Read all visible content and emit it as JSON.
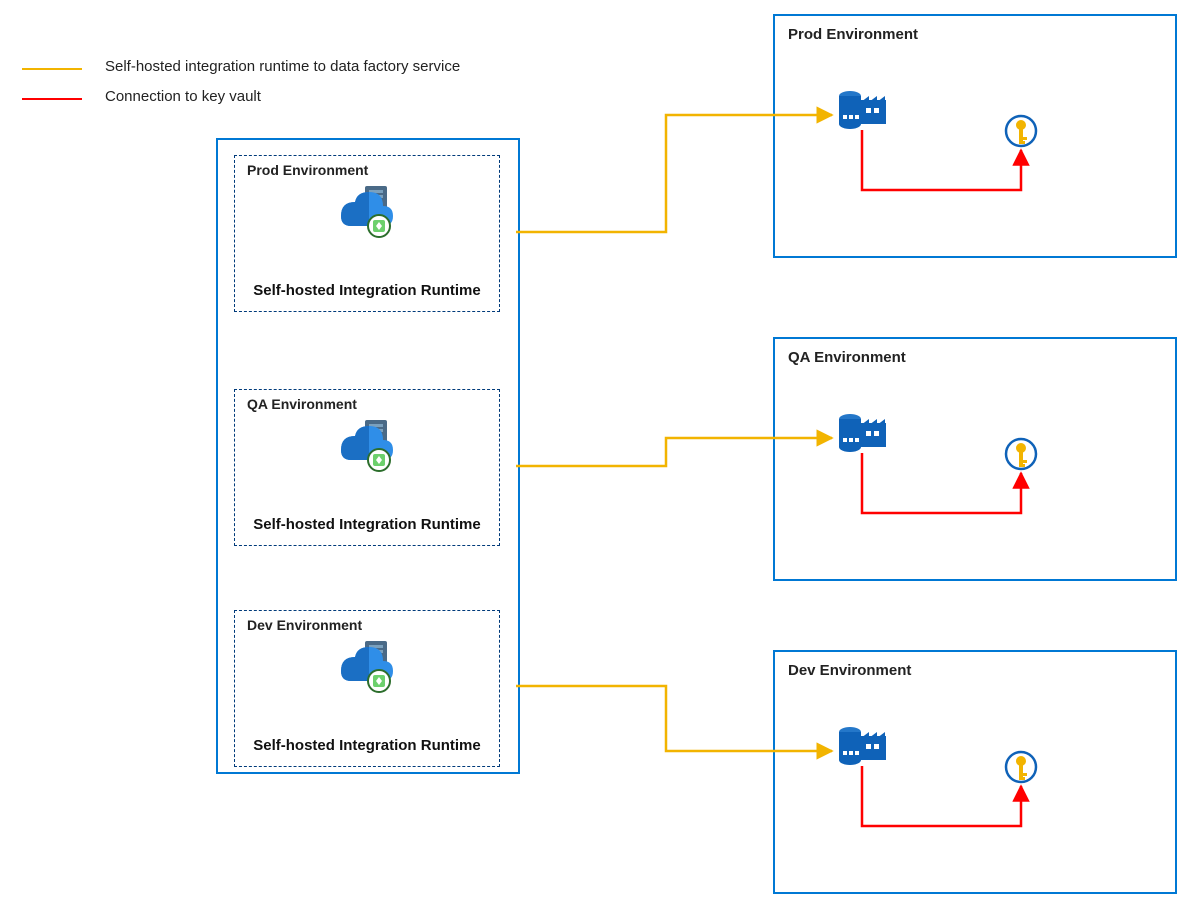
{
  "legend": {
    "line1": "Self-hosted integration runtime to data factory service",
    "line2": "Connection to key vault"
  },
  "left": {
    "prod": {
      "title": "Prod Environment",
      "label": "Self-hosted Integration Runtime"
    },
    "qa": {
      "title": "QA Environment",
      "label": "Self-hosted Integration Runtime"
    },
    "dev": {
      "title": "Dev Environment",
      "label": "Self-hosted Integration Runtime"
    }
  },
  "right": {
    "prod": {
      "title": "Prod Environment"
    },
    "qa": {
      "title": "QA Environment"
    },
    "dev": {
      "title": "Dev Environment"
    }
  },
  "colors": {
    "yellow": "#f2b400",
    "red": "#ff0000",
    "blue": "#0078d4",
    "darkblue": "#003a7a"
  }
}
